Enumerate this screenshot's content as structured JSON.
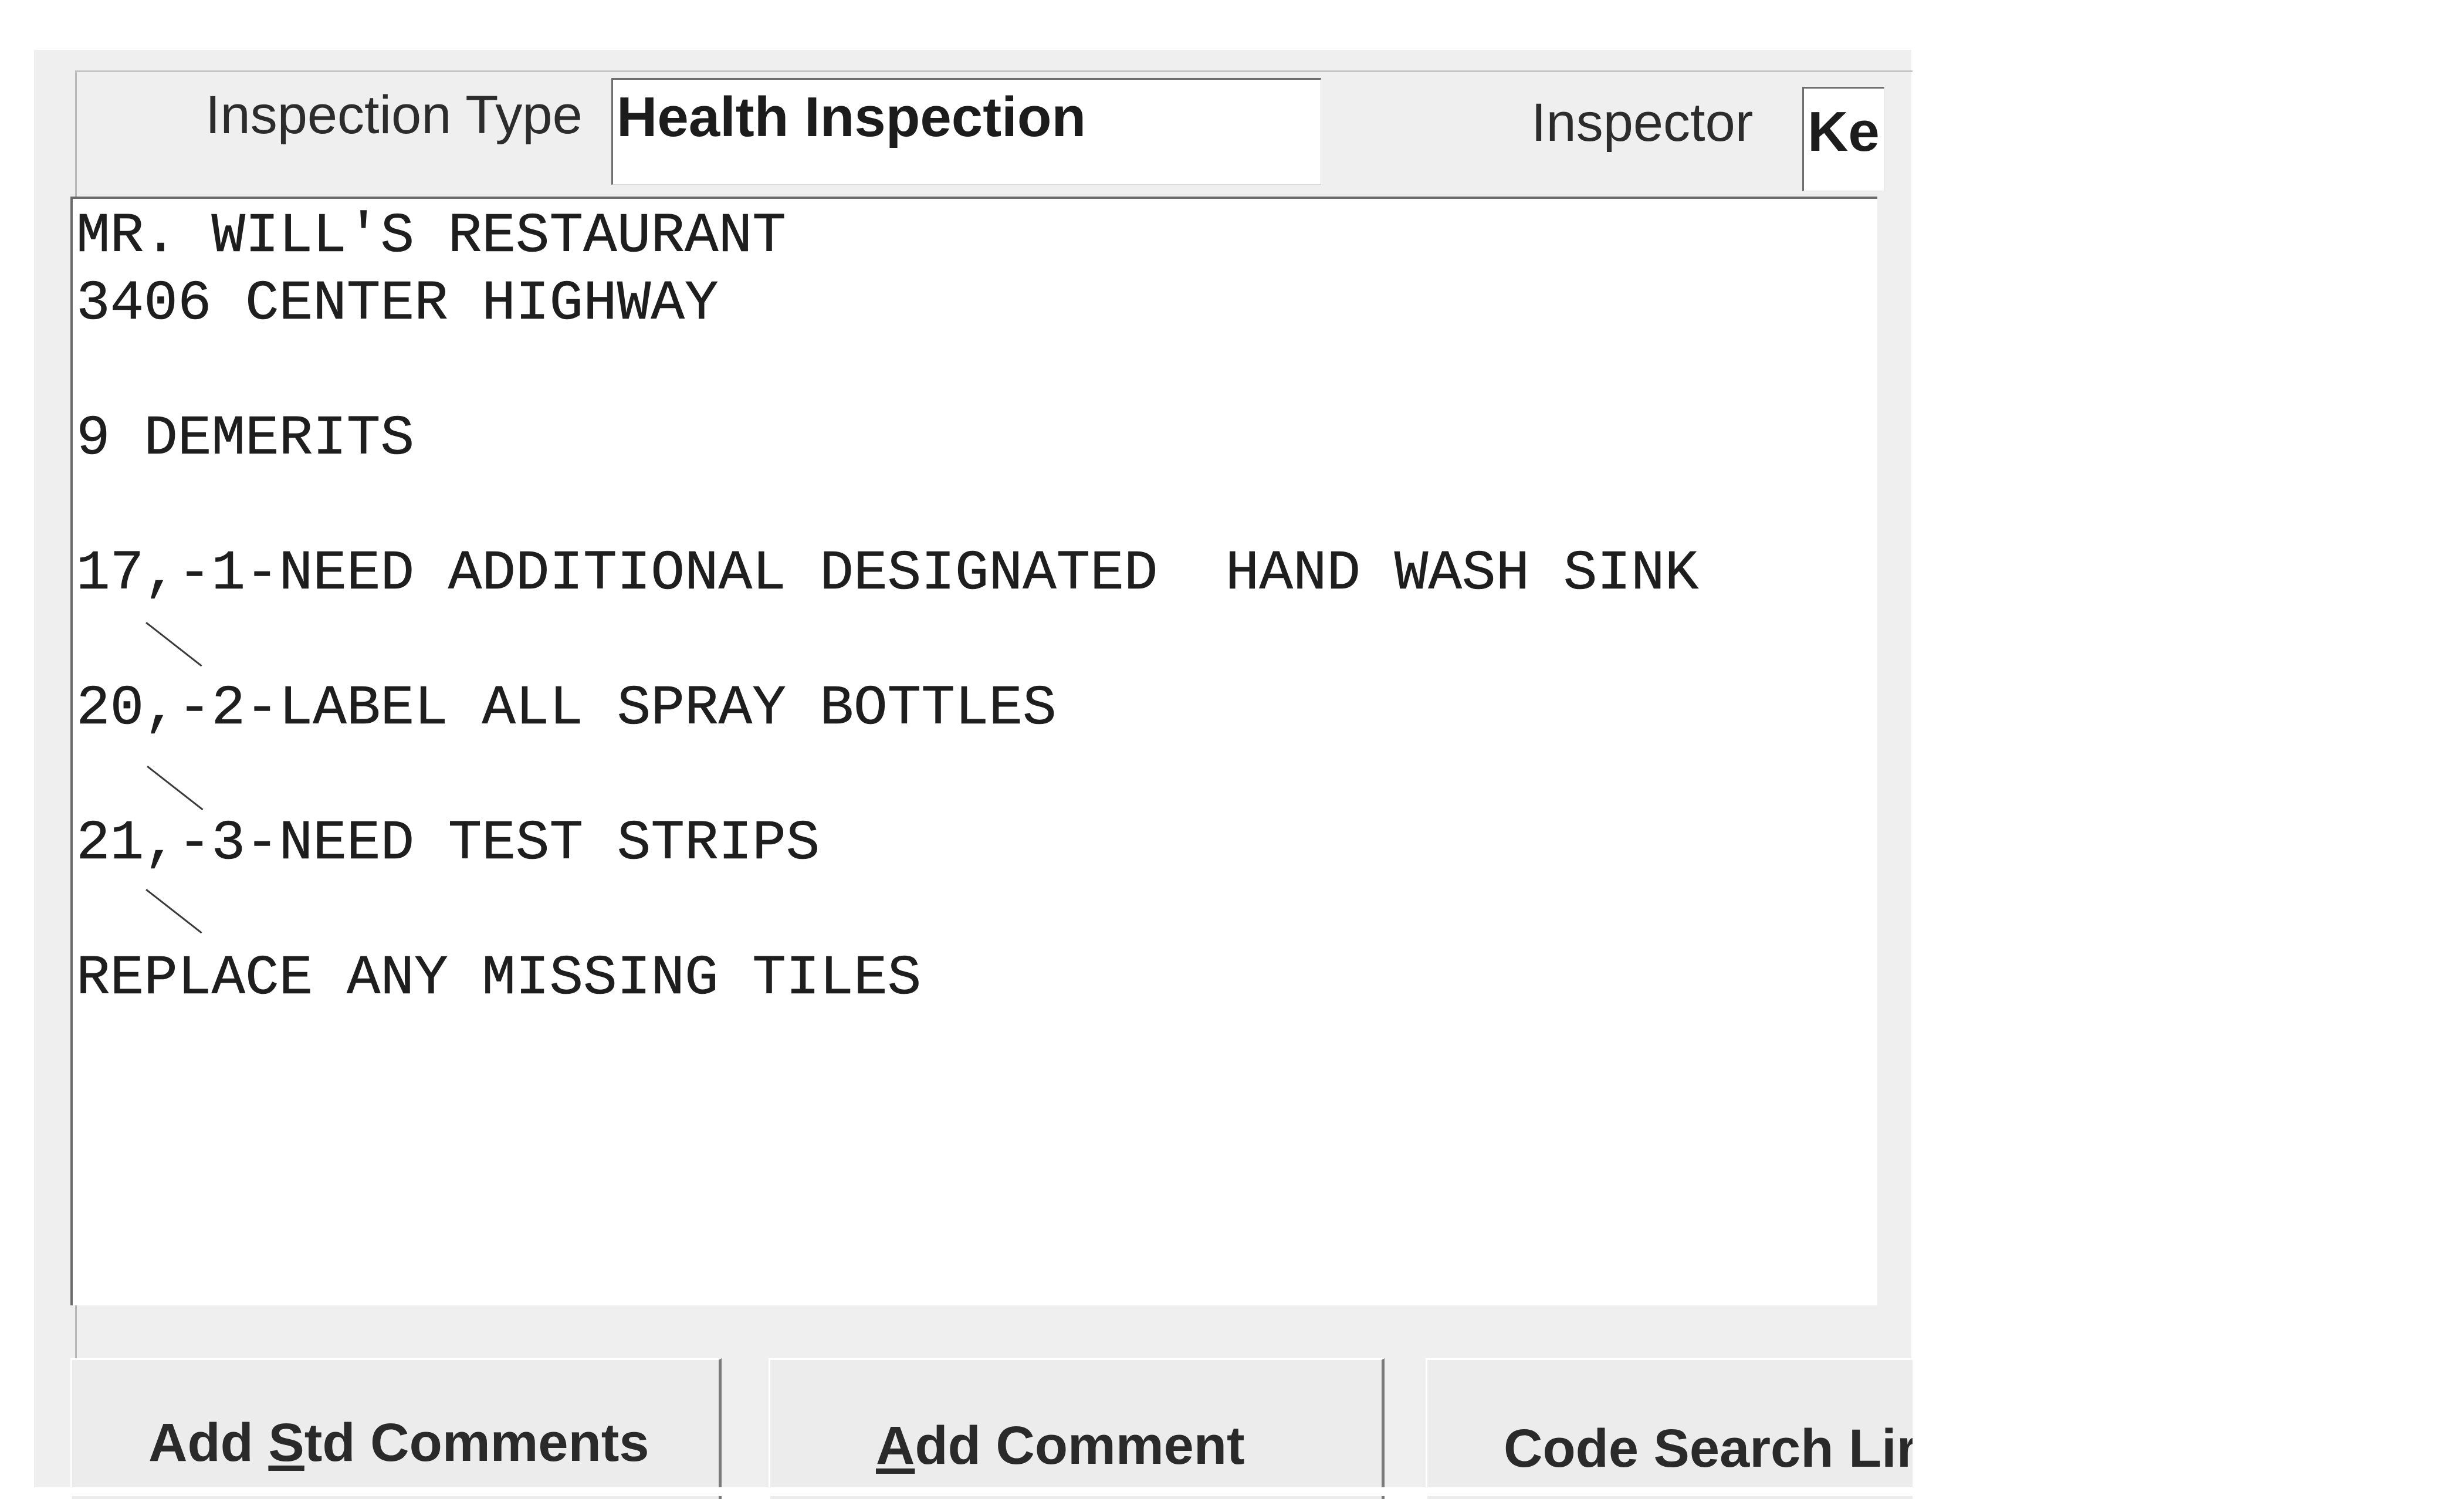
{
  "form": {
    "inspection_type_label": "Inspection Type",
    "inspection_type_value": "Health Inspection",
    "inspector_label": "Inspector",
    "inspector_value": "Ke"
  },
  "notes": {
    "text": "MR. WILL'S RESTAURANT\n3406 CENTER HIGHWAY\n\n9 DEMERITS\n\n17,-1-NEED ADDITIONAL DESIGNATED  HAND WASH SINK\n\n20,-2-LABEL ALL SPRAY BOTTLES\n\n21,-3-NEED TEST STRIPS\n\nREPLACE ANY MISSING TILES"
  },
  "buttons": {
    "add_std_comments": {
      "before": "Add ",
      "mnemonic": "S",
      "after": "td Comments"
    },
    "add_comment": {
      "before": "",
      "mnemonic": "A",
      "after": "dd Comment"
    },
    "code_search": {
      "label": "Code Search Lir"
    }
  }
}
